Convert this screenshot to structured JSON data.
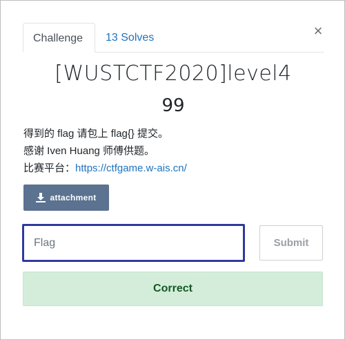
{
  "tabs": {
    "challenge_label": "Challenge",
    "solves_label": "13 Solves"
  },
  "close_glyph": "×",
  "challenge": {
    "name": "[WUSTCTF2020]level4",
    "value": "99",
    "description_line1": "得到的 flag 请包上 flag{} 提交。",
    "description_line2": "感谢 Iven Huang 师傅供题。",
    "platform_prefix": "比赛平台：",
    "platform_link": "https://ctfgame.w-ais.cn/"
  },
  "attachment": {
    "label": "attachment",
    "icon": "download-icon"
  },
  "flag_input": {
    "placeholder": "Flag",
    "value": ""
  },
  "submit_label": "Submit",
  "result_message": "Correct",
  "colors": {
    "link": "#1e73be",
    "attachment_bg": "#5b7290",
    "input_border": "#2e3a9c",
    "success_bg": "#d4edda",
    "success_text": "#155724"
  }
}
